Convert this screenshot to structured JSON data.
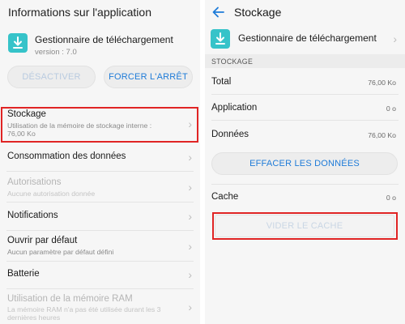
{
  "left": {
    "title": "Informations sur l'application",
    "app": {
      "name": "Gestionnaire de téléchargement",
      "version": "version : 7.0",
      "icon": "download-icon",
      "icon_color": "#36c3c9"
    },
    "buttons": {
      "disable": "DÉSACTIVER",
      "force_stop": "FORCER L'ARRÊT"
    },
    "items": [
      {
        "label": "Stockage",
        "sub_line1": "Utilisation de la mémoire de stockage interne :",
        "sub_line2": "76,00 Ko",
        "enabled": true
      },
      {
        "label": "Consommation des données",
        "enabled": true
      },
      {
        "label": "Autorisations",
        "sub_line1": "Aucune autorisation donnée",
        "enabled": false
      },
      {
        "label": "Notifications",
        "enabled": true
      },
      {
        "label": "Ouvrir par défaut",
        "sub_line1": "Aucun paramètre par défaut défini",
        "enabled": true
      },
      {
        "label": "Batterie",
        "enabled": true
      },
      {
        "label": "Utilisation de la mémoire RAM",
        "sub_line1": "La mémoire RAM n'a pas été utilisée durant les 3",
        "sub_line2": "dernières heures",
        "enabled": false
      }
    ]
  },
  "right": {
    "title": "Stockage",
    "app": {
      "name": "Gestionnaire de téléchargement"
    },
    "section": "STOCKAGE",
    "rows": [
      {
        "label": "Total",
        "value": "76,00 Ko"
      },
      {
        "label": "Application",
        "value": "0 o"
      },
      {
        "label": "Données",
        "value": "76,00 Ko"
      }
    ],
    "clear_data_button": "EFFACER LES DONNÉES",
    "cache": {
      "label": "Cache",
      "value": "0 o"
    },
    "clear_cache_button": "VIDER LE CACHE"
  },
  "colors": {
    "accent": "#1e7bd8",
    "highlight": "#e02424",
    "app_icon": "#36c3c9"
  }
}
